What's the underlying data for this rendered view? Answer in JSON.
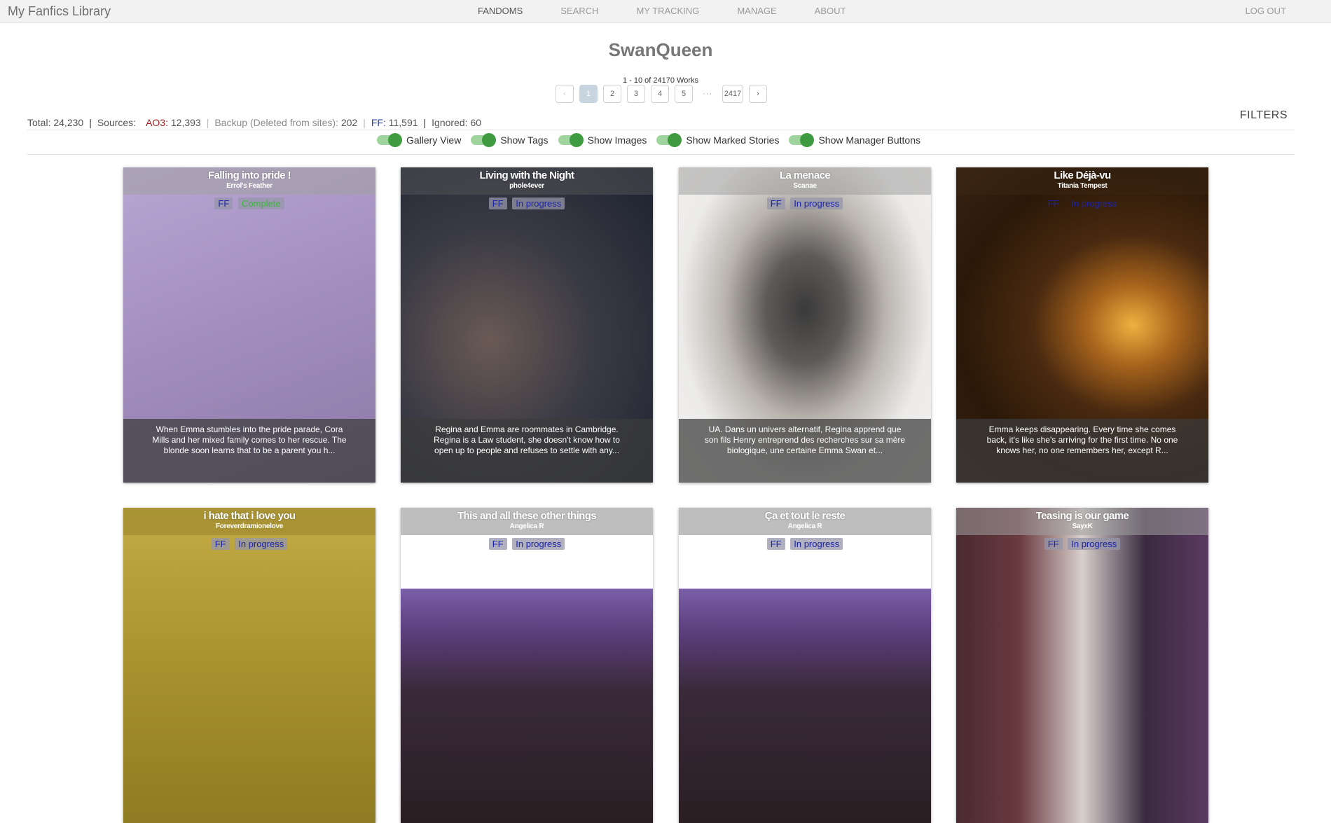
{
  "nav": {
    "brand": "My Fanfics Library",
    "links": [
      "FANDOMS",
      "SEARCH",
      "MY TRACKING",
      "MANAGE",
      "ABOUT"
    ],
    "logout": "LOG OUT"
  },
  "header": {
    "fandom": "SwanQueen",
    "works_count": "1 - 10 of 24170 Works"
  },
  "pagination": {
    "prev": "‹",
    "pages": [
      "1",
      "2",
      "3",
      "4",
      "5"
    ],
    "ellipsis": "···",
    "last": "2417",
    "next": "›",
    "current": "1"
  },
  "stats": {
    "total_label": "Total:",
    "total_value": "24,230",
    "sources_label": "Sources:",
    "ao3_label": "AO3:",
    "ao3_value": "12,393",
    "backup_label": "Backup (Deleted from sites):",
    "backup_value": "202",
    "ff_label": "FF:",
    "ff_value": "11,591",
    "ignored_label": "Ignored:",
    "ignored_value": "60"
  },
  "filters_label": "FILTERS",
  "toggles": [
    {
      "label": "Gallery View",
      "on": true
    },
    {
      "label": "Show Tags",
      "on": true
    },
    {
      "label": "Show Images",
      "on": true
    },
    {
      "label": "Show Marked Stories",
      "on": true
    },
    {
      "label": "Show Manager Buttons",
      "on": true
    }
  ],
  "cards": [
    {
      "title": "Falling into pride !",
      "author": "Errol's Feather",
      "source": "FF",
      "status": "Complete",
      "summary": "When Emma stumbles into the pride parade, Cora Mills and her mixed family comes to her rescue. The blonde soon learns that to be a parent you h...",
      "art": "#a48fc0"
    },
    {
      "title": "Living with the Night",
      "author": "phole4ever",
      "source": "FF",
      "status": "In progress",
      "summary": "Regina and Emma are roommates in Cambridge. Regina is a Law student, she doesn't know how to open up to people and refuses to settle with any...",
      "art": "#2f3540"
    },
    {
      "title": "La menace",
      "author": "Scanae",
      "source": "FF",
      "status": "In progress",
      "summary": "UA. Dans un univers alternatif, Regina apprend que son fils Henry entreprend des recherches sur sa mère biologique, une certaine Emma Swan et...",
      "art": "#e8e4e0"
    },
    {
      "title": "Like Déjà-vu",
      "author": "Titania Tempest",
      "source": "FF",
      "status": "In progress",
      "summary": "Emma keeps disappearing. Every time she comes back, it's like she's arriving for the first time. No one knows her, no one remembers her, except R...",
      "art": "#5a3a1a"
    },
    {
      "title": "i hate that i love you",
      "author": "Foreverdramionelove",
      "source": "FF",
      "status": "In progress",
      "summary": "",
      "art": "#a8922e"
    },
    {
      "title": "This and all these other things",
      "author": "Angelica R",
      "source": "FF",
      "status": "In progress",
      "summary": "",
      "art": "#5a3d7a"
    },
    {
      "title": "Ça et tout le reste",
      "author": "Angelica R",
      "source": "FF",
      "status": "In progress",
      "summary": "",
      "art": "#5a3d7a"
    },
    {
      "title": "Teasing is our game",
      "author": "SayxK",
      "source": "FF",
      "status": "In progress",
      "summary": "",
      "art": "#d8d0cc"
    }
  ]
}
